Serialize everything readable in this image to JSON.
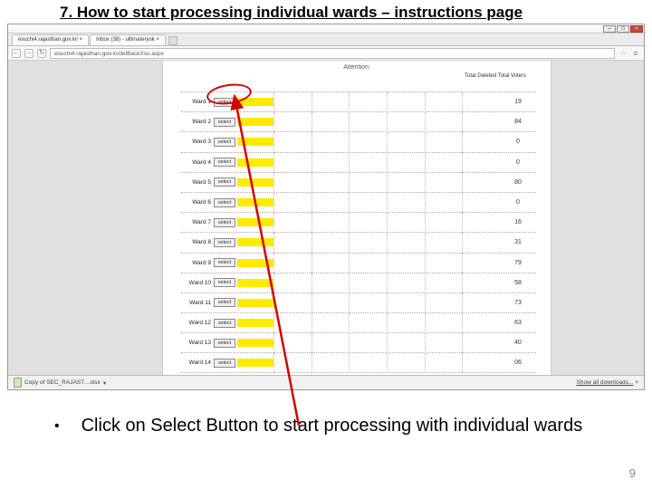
{
  "slide": {
    "title": "7. How to start processing individual wards – instructions page",
    "page_number": "9",
    "bullet": "Click on Select Button to start processing with individual wards"
  },
  "browser": {
    "tabs": [
      "esuchi4.rajasthan.gov.in/ ×",
      "Inbox (38) - ultimateryok ×"
    ],
    "url": "esuchi4.rajasthan.gov.in/delBackXss.aspx",
    "download_file": "Copy of SEC_RAJAST....xlsx",
    "download_link": "Show all downloads...",
    "window_close": "×"
  },
  "page": {
    "attention": "Attention:",
    "col_header": "Total Deleted Total Voters",
    "select_label": "select",
    "wards": [
      {
        "label": "Ward 1",
        "value": "19"
      },
      {
        "label": "Ward 2",
        "value": "84"
      },
      {
        "label": "Ward 3",
        "value": "0"
      },
      {
        "label": "Ward 4",
        "value": "0"
      },
      {
        "label": "Ward 5",
        "value": "80"
      },
      {
        "label": "Ward 6",
        "value": "0"
      },
      {
        "label": "Ward 7",
        "value": "16"
      },
      {
        "label": "Ward 8",
        "value": "31"
      },
      {
        "label": "Ward 9",
        "value": "79"
      },
      {
        "label": "Ward 10",
        "value": "58"
      },
      {
        "label": "Ward 11",
        "value": "73"
      },
      {
        "label": "Ward 12",
        "value": "63"
      },
      {
        "label": "Ward 13",
        "value": "40"
      },
      {
        "label": "Ward 14",
        "value": "06"
      }
    ]
  },
  "annotation": {
    "arrow_color": "#d40000"
  }
}
